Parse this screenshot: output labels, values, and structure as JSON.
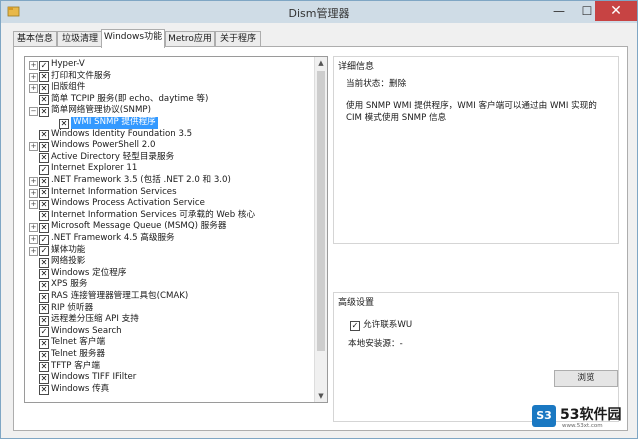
{
  "window": {
    "title": "Dism管理器",
    "min": "—",
    "max": "☐",
    "close": "✕"
  },
  "tabs": [
    "基本信息",
    "垃圾清理",
    "Windows功能",
    "Metro应用",
    "关于程序"
  ],
  "tree": {
    "items": [
      {
        "label": "Hyper-V",
        "expander": "+",
        "checked": "✓"
      },
      {
        "label": "打印和文件服务",
        "expander": "+",
        "checked": "✕"
      },
      {
        "label": "旧版组件",
        "expander": "+",
        "checked": "✕"
      },
      {
        "label": "简单 TCPIP 服务(即 echo、daytime 等)",
        "expander": "",
        "checked": "✕"
      },
      {
        "label": "简单网络管理协议(SNMP)",
        "expander": "−",
        "checked": "✕"
      },
      {
        "label": "WMI SNMP 提供程序",
        "expander": "",
        "checked": "✕",
        "child": true,
        "selected": true
      },
      {
        "label": "Windows Identity Foundation 3.5",
        "expander": "",
        "checked": "✕"
      },
      {
        "label": "Windows PowerShell 2.0",
        "expander": "+",
        "checked": "✕"
      },
      {
        "label": "Active Directory 轻型目录服务",
        "expander": "",
        "checked": "✕"
      },
      {
        "label": "Internet Explorer 11",
        "expander": "",
        "checked": "✓"
      },
      {
        "label": ".NET Framework 3.5 (包括 .NET 2.0 和 3.0)",
        "expander": "+",
        "checked": "✕"
      },
      {
        "label": "Internet Information Services",
        "expander": "+",
        "checked": "✕"
      },
      {
        "label": "Windows Process Activation Service",
        "expander": "+",
        "checked": "✕"
      },
      {
        "label": "Internet Information Services 可承载的 Web 核心",
        "expander": "",
        "checked": "✕"
      },
      {
        "label": "Microsoft Message Queue (MSMQ) 服务器",
        "expander": "+",
        "checked": "✕"
      },
      {
        "label": ".NET Framework 4.5 高级服务",
        "expander": "+",
        "checked": "✓"
      },
      {
        "label": "媒体功能",
        "expander": "+",
        "checked": "✓"
      },
      {
        "label": "网络投影",
        "expander": "",
        "checked": "✕"
      },
      {
        "label": "Windows 定位程序",
        "expander": "",
        "checked": "✕"
      },
      {
        "label": "XPS 服务",
        "expander": "",
        "checked": "✕"
      },
      {
        "label": "RAS 连接管理器管理工具包(CMAK)",
        "expander": "",
        "checked": "✕"
      },
      {
        "label": "RIP 侦听器",
        "expander": "",
        "checked": "✕"
      },
      {
        "label": "远程差分压缩 API 支持",
        "expander": "",
        "checked": "✕"
      },
      {
        "label": "Windows Search",
        "expander": "",
        "checked": "✓"
      },
      {
        "label": "Telnet 客户端",
        "expander": "",
        "checked": "✕"
      },
      {
        "label": "Telnet 服务器",
        "expander": "",
        "checked": "✕"
      },
      {
        "label": "TFTP 客户端",
        "expander": "",
        "checked": "✕"
      },
      {
        "label": "Windows TIFF IFilter",
        "expander": "",
        "checked": "✕"
      },
      {
        "label": "Windows 传真",
        "expander": "",
        "checked": "✕"
      }
    ]
  },
  "details": {
    "heading": "详细信息",
    "status": "当前状态：删除",
    "description": "使用 SNMP WMI 提供程序，WMI 客户端可以通过由 WMI 实现的 CIM 模式使用 SNMP 信息"
  },
  "advanced": {
    "heading": "高级设置",
    "allow_network_label": "允许联系WU",
    "allow_network_checked": "✓",
    "local_source": "本地安装源：-",
    "browse_button": "浏览"
  },
  "watermark": {
    "logo": "S3",
    "text": "53软件园",
    "url": "www.53xt.com"
  }
}
